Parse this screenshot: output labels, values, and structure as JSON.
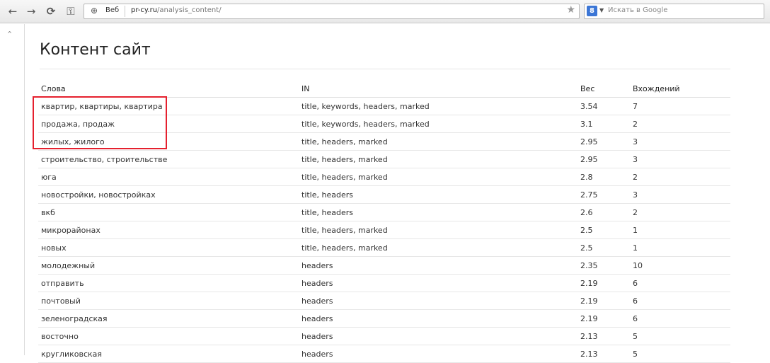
{
  "browser": {
    "back_icon": "←",
    "forward_icon": "→",
    "reload_icon": "⟳",
    "key_icon": "⚿",
    "address": {
      "scheme_label": "Веб",
      "host": "pr-cy.ru",
      "path": "/analysis_content/"
    },
    "search": {
      "engine": "8",
      "placeholder": "Искать в Google"
    }
  },
  "page": {
    "title": "Контент сайт",
    "columns": [
      "Слова",
      "IN",
      "Вес",
      "Вхождений"
    ],
    "rows": [
      {
        "words": "квартир, квартиры, квартира",
        "in": "title, keywords, headers, marked",
        "weight": "3.54",
        "count": "7"
      },
      {
        "words": "продажа, продаж",
        "in": "title, keywords, headers, marked",
        "weight": "3.1",
        "count": "2"
      },
      {
        "words": "жилых, жилого",
        "in": "title, headers, marked",
        "weight": "2.95",
        "count": "3"
      },
      {
        "words": "строительство, строительстве",
        "in": "title, headers, marked",
        "weight": "2.95",
        "count": "3"
      },
      {
        "words": "юга",
        "in": "title, headers, marked",
        "weight": "2.8",
        "count": "2"
      },
      {
        "words": "новостройки, новостройках",
        "in": "title, headers",
        "weight": "2.75",
        "count": "3"
      },
      {
        "words": "вкб",
        "in": "title, headers",
        "weight": "2.6",
        "count": "2"
      },
      {
        "words": "микрорайонах",
        "in": "title, headers, marked",
        "weight": "2.5",
        "count": "1"
      },
      {
        "words": "новых",
        "in": "title, headers, marked",
        "weight": "2.5",
        "count": "1"
      },
      {
        "words": "молодежный",
        "in": "headers",
        "weight": "2.35",
        "count": "10"
      },
      {
        "words": "отправить",
        "in": "headers",
        "weight": "2.19",
        "count": "6"
      },
      {
        "words": "почтовый",
        "in": "headers",
        "weight": "2.19",
        "count": "6"
      },
      {
        "words": "зеленоградская",
        "in": "headers",
        "weight": "2.19",
        "count": "6"
      },
      {
        "words": "восточно",
        "in": "headers",
        "weight": "2.13",
        "count": "5"
      },
      {
        "words": "кругликовская",
        "in": "headers",
        "weight": "2.13",
        "count": "5"
      }
    ]
  },
  "colors": {
    "highlight": "#e5202e"
  }
}
